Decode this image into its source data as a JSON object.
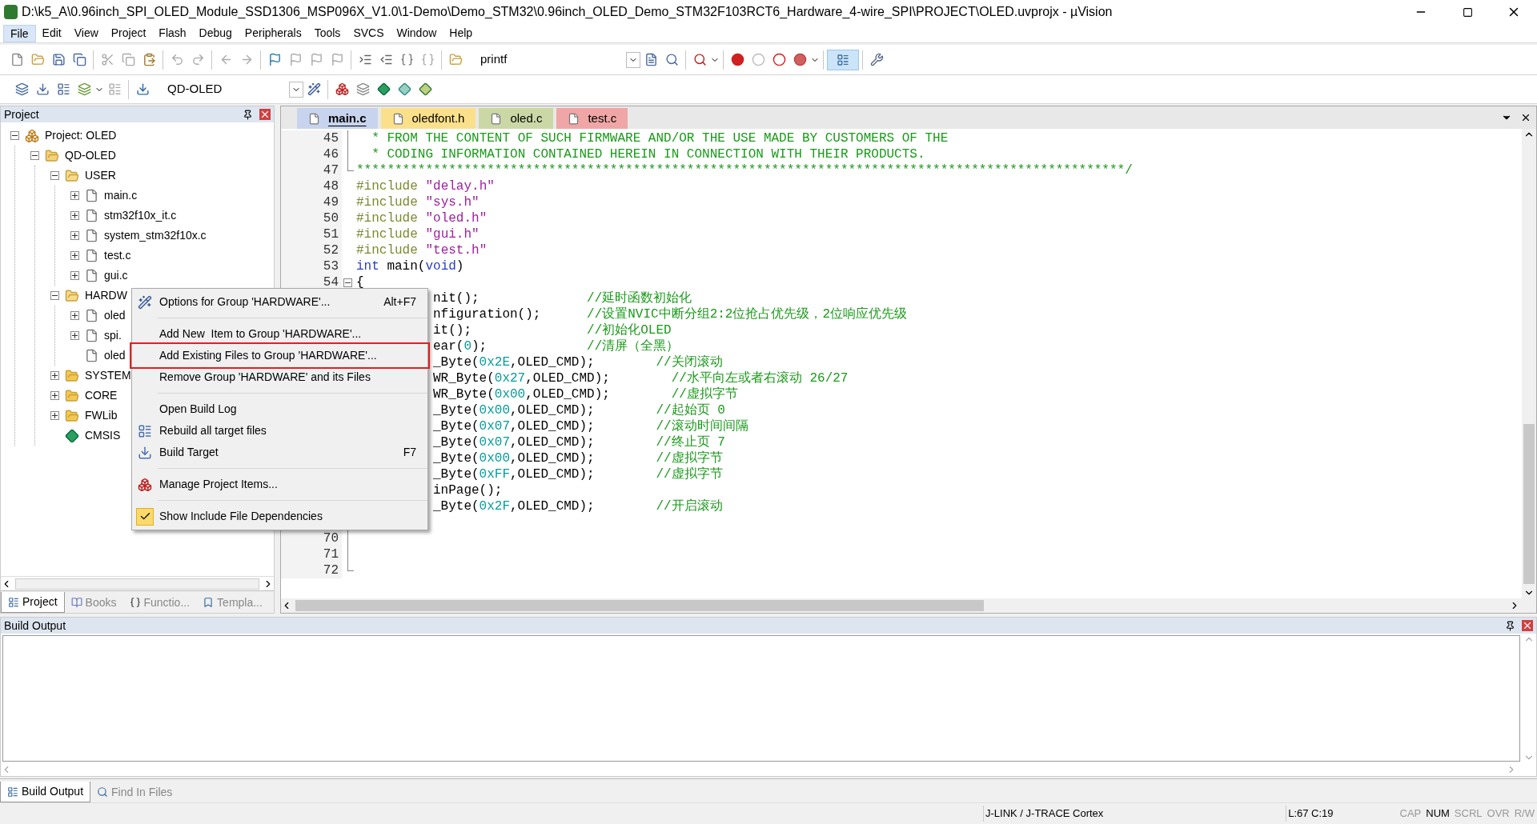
{
  "window": {
    "title": "D:\\k5_A\\0.96inch_SPI_OLED_Module_SSD1306_MSP096X_V1.0\\1-Demo\\Demo_STM32\\0.96inch_OLED_Demo_STM32F103RCT6_Hardware_4-wire_SPI\\PROJECT\\OLED.uvprojx - µVision"
  },
  "menu": [
    {
      "label": "File",
      "selected": true
    },
    {
      "label": "Edit",
      "selected": false
    },
    {
      "label": "View",
      "selected": false
    },
    {
      "label": "Project",
      "selected": false
    },
    {
      "label": "Flash",
      "selected": false
    },
    {
      "label": "Debug",
      "selected": false
    },
    {
      "label": "Peripherals",
      "selected": false
    },
    {
      "label": "Tools",
      "selected": false
    },
    {
      "label": "SVCS",
      "selected": false
    },
    {
      "label": "Window",
      "selected": false
    },
    {
      "label": "Help",
      "selected": false
    }
  ],
  "toolbar": {
    "find_value": "printf",
    "target": "QD-OLED"
  },
  "project_panel": {
    "title": "Project",
    "tree": [
      {
        "label": "Project: OLED",
        "kind": "project",
        "expanded": true,
        "children": [
          {
            "label": "QD-OLED",
            "kind": "target",
            "expanded": true,
            "children": [
              {
                "label": "USER",
                "kind": "folder",
                "expanded": true,
                "children": [
                  {
                    "label": "main.c",
                    "kind": "file",
                    "expanded": false
                  },
                  {
                    "label": "stm32f10x_it.c",
                    "kind": "file",
                    "expanded": false
                  },
                  {
                    "label": "system_stm32f10x.c",
                    "kind": "file",
                    "expanded": false
                  },
                  {
                    "label": "test.c",
                    "kind": "file",
                    "expanded": false
                  },
                  {
                    "label": "gui.c",
                    "kind": "file",
                    "expanded": false
                  }
                ]
              },
              {
                "label": "HARDW",
                "kind": "folder",
                "expanded": true,
                "children": [
                  {
                    "label": "oled",
                    "kind": "file",
                    "expanded": false
                  },
                  {
                    "label": "spi.",
                    "kind": "file",
                    "expanded": false
                  },
                  {
                    "label": "oled",
                    "kind": "file"
                  }
                ]
              },
              {
                "label": "SYSTEM",
                "kind": "folder",
                "expanded": false
              },
              {
                "label": "CORE",
                "kind": "folder",
                "expanded": false
              },
              {
                "label": "FWLib",
                "kind": "folder",
                "expanded": false
              },
              {
                "label": "CMSIS",
                "kind": "components"
              }
            ]
          }
        ]
      }
    ],
    "tabs": [
      {
        "label": "Project",
        "selected": true
      },
      {
        "label": "Books",
        "selected": false
      },
      {
        "label": "Functio...",
        "selected": false
      },
      {
        "label": "Templa...",
        "selected": false
      }
    ]
  },
  "editor": {
    "tabs": [
      {
        "label": "main.c",
        "color": "#c8d4ee",
        "selected": true
      },
      {
        "label": "oledfont.h",
        "color": "#fbe08c",
        "selected": false
      },
      {
        "label": "oled.c",
        "color": "#cbd8a6",
        "selected": false
      },
      {
        "label": "test.c",
        "color": "#f0a6a6",
        "selected": false
      }
    ],
    "lines": [
      {
        "kind": "fold-bar",
        "num": "45",
        "parts": [
          {
            "kind": "comment",
            "t": "  * FROM THE CONTENT OF SUCH FIRMWARE AND/OR THE USE MADE BY CUSTOMERS OF THE"
          }
        ]
      },
      {
        "kind": "fold-bar",
        "num": "46",
        "parts": [
          {
            "kind": "comment",
            "t": "  * CODING INFORMATION CONTAINED HEREIN IN CONNECTION WITH THEIR PRODUCTS."
          }
        ]
      },
      {
        "kind": "fold-end",
        "num": "47",
        "parts": [
          {
            "kind": "comment",
            "t": "****************************************************************************************************/"
          }
        ]
      },
      {
        "kind": "plain",
        "num": "48",
        "parts": [
          {
            "kind": "directive",
            "t": "#include "
          },
          {
            "kind": "string",
            "t": "\"delay.h\""
          }
        ]
      },
      {
        "kind": "plain",
        "num": "49",
        "parts": [
          {
            "kind": "directive",
            "t": "#include "
          },
          {
            "kind": "string",
            "t": "\"sys.h\""
          }
        ]
      },
      {
        "kind": "plain",
        "num": "50",
        "parts": [
          {
            "kind": "directive",
            "t": "#include "
          },
          {
            "kind": "string",
            "t": "\"oled.h\""
          }
        ]
      },
      {
        "kind": "plain",
        "num": "51",
        "parts": [
          {
            "kind": "directive",
            "t": "#include "
          },
          {
            "kind": "string",
            "t": "\"gui.h\""
          }
        ]
      },
      {
        "kind": "plain",
        "num": "52",
        "parts": [
          {
            "kind": "directive",
            "t": "#include "
          },
          {
            "kind": "string",
            "t": "\"test.h\""
          }
        ]
      },
      {
        "kind": "plain",
        "num": "53",
        "parts": [
          {
            "kind": "keyword",
            "t": "int"
          },
          {
            "kind": "text",
            "t": " main("
          },
          {
            "kind": "keyword",
            "t": "void"
          },
          {
            "kind": "text",
            "t": ")"
          }
        ]
      },
      {
        "kind": "fold-open",
        "num": "54",
        "parts": [
          {
            "kind": "text",
            "t": "{"
          }
        ]
      },
      {
        "kind": "clipped",
        "parts": [
          {
            "kind": "text",
            "t": "nit();              "
          },
          {
            "kind": "comment",
            "t": "//延时函数初始化"
          }
        ]
      },
      {
        "kind": "clipped",
        "parts": [
          {
            "kind": "text",
            "t": "nfiguration();      "
          },
          {
            "kind": "comment",
            "t": "//设置NVIC中断分组2:2位抢占优先级，2位响应优先级"
          }
        ]
      },
      {
        "kind": "clipped",
        "parts": [
          {
            "kind": "text",
            "t": "it();               "
          },
          {
            "kind": "comment",
            "t": "//初始化OLED"
          }
        ]
      },
      {
        "kind": "clipped",
        "parts": [
          {
            "kind": "text",
            "t": "ear("
          },
          {
            "kind": "number",
            "t": "0"
          },
          {
            "kind": "text",
            "t": ");             "
          },
          {
            "kind": "comment",
            "t": "//清屏（全黑）"
          }
        ]
      },
      {
        "kind": "clipped",
        "parts": [
          {
            "kind": "text",
            "t": "_Byte("
          },
          {
            "kind": "number",
            "t": "0x2E"
          },
          {
            "kind": "text",
            "t": ",OLED_CMD);        "
          },
          {
            "kind": "comment",
            "t": "//关闭滚动"
          }
        ]
      },
      {
        "kind": "clipped",
        "parts": [
          {
            "kind": "text",
            "t": "WR_Byte("
          },
          {
            "kind": "number",
            "t": "0x27"
          },
          {
            "kind": "text",
            "t": ",OLED_CMD);        "
          },
          {
            "kind": "comment",
            "t": "//水平向左或者右滚动 26/27"
          }
        ]
      },
      {
        "kind": "clipped",
        "parts": [
          {
            "kind": "text",
            "t": "WR_Byte("
          },
          {
            "kind": "number",
            "t": "0x00"
          },
          {
            "kind": "text",
            "t": ",OLED_CMD);        "
          },
          {
            "kind": "comment",
            "t": "//虚拟字节"
          }
        ]
      },
      {
        "kind": "clipped",
        "parts": [
          {
            "kind": "text",
            "t": "_Byte("
          },
          {
            "kind": "number",
            "t": "0x00"
          },
          {
            "kind": "text",
            "t": ",OLED_CMD);        "
          },
          {
            "kind": "comment",
            "t": "//起始页 0"
          }
        ]
      },
      {
        "kind": "clipped",
        "parts": [
          {
            "kind": "text",
            "t": "_Byte("
          },
          {
            "kind": "number",
            "t": "0x07"
          },
          {
            "kind": "text",
            "t": ",OLED_CMD);        "
          },
          {
            "kind": "comment",
            "t": "//滚动时间间隔"
          }
        ]
      },
      {
        "kind": "clipped",
        "parts": [
          {
            "kind": "text",
            "t": "_Byte("
          },
          {
            "kind": "number",
            "t": "0x07"
          },
          {
            "kind": "text",
            "t": ",OLED_CMD);        "
          },
          {
            "kind": "comment",
            "t": "//终止页 7"
          }
        ]
      },
      {
        "kind": "clipped",
        "parts": [
          {
            "kind": "text",
            "t": "_Byte("
          },
          {
            "kind": "number",
            "t": "0x00"
          },
          {
            "kind": "text",
            "t": ",OLED_CMD);        "
          },
          {
            "kind": "comment",
            "t": "//虚拟字节"
          }
        ]
      },
      {
        "kind": "clipped",
        "parts": [
          {
            "kind": "text",
            "t": "_Byte("
          },
          {
            "kind": "number",
            "t": "0xFF"
          },
          {
            "kind": "text",
            "t": ",OLED_CMD);        "
          },
          {
            "kind": "comment",
            "t": "//虚拟字节"
          }
        ]
      },
      {
        "kind": "clipped",
        "parts": [
          {
            "kind": "text",
            "t": "inPage();"
          }
        ]
      },
      {
        "kind": "clipped",
        "parts": [
          {
            "kind": "text",
            "t": "_Byte("
          },
          {
            "kind": "number",
            "t": "0x2F"
          },
          {
            "kind": "text",
            "t": ",OLED_CMD);        "
          },
          {
            "kind": "comment",
            "t": "//开启滚动"
          }
        ]
      },
      {
        "kind": "covered"
      },
      {
        "kind": "fold-bar",
        "num": "70"
      },
      {
        "kind": "fold-bar",
        "num": "71"
      },
      {
        "kind": "fold-end",
        "num": "72"
      }
    ]
  },
  "context_menu": [
    {
      "kind": "item",
      "label": "Options for Group 'HARDWARE'...",
      "shortcut": "Alt+F7",
      "highlighted": false,
      "checked": false
    },
    {
      "kind": "separator"
    },
    {
      "kind": "item",
      "label": "Add New  Item to Group 'HARDWARE'...",
      "highlighted": false,
      "checked": false
    },
    {
      "kind": "item",
      "label": "Add Existing Files to Group 'HARDWARE'...",
      "highlighted": true,
      "checked": false
    },
    {
      "kind": "item",
      "label": "Remove Group 'HARDWARE' and its Files",
      "highlighted": false,
      "checked": false
    },
    {
      "kind": "separator"
    },
    {
      "kind": "item",
      "label": "Open Build Log",
      "highlighted": false,
      "checked": false
    },
    {
      "kind": "item",
      "label": "Rebuild all target files",
      "highlighted": false,
      "checked": false
    },
    {
      "kind": "item",
      "label": "Build Target",
      "shortcut": "F7",
      "highlighted": false,
      "checked": false
    },
    {
      "kind": "separator"
    },
    {
      "kind": "item",
      "label": "Manage Project Items...",
      "highlighted": false,
      "checked": false
    },
    {
      "kind": "separator"
    },
    {
      "kind": "item",
      "label": "Show Include File Dependencies",
      "highlighted": false,
      "checked": true
    }
  ],
  "build_output": {
    "title": "Build Output",
    "tabs": [
      {
        "label": "Build Output",
        "selected": true
      },
      {
        "label": "Find In Files",
        "selected": false
      }
    ]
  },
  "status_bar": {
    "target": "J-LINK / J-TRACE Cortex",
    "position": "L:67 C:19",
    "indicators": [
      {
        "label": "CAP",
        "on": false
      },
      {
        "label": "NUM",
        "on": true
      },
      {
        "label": "SCRL",
        "on": false
      },
      {
        "label": "OVR",
        "on": false
      },
      {
        "label": "R/W",
        "on": false
      }
    ]
  }
}
